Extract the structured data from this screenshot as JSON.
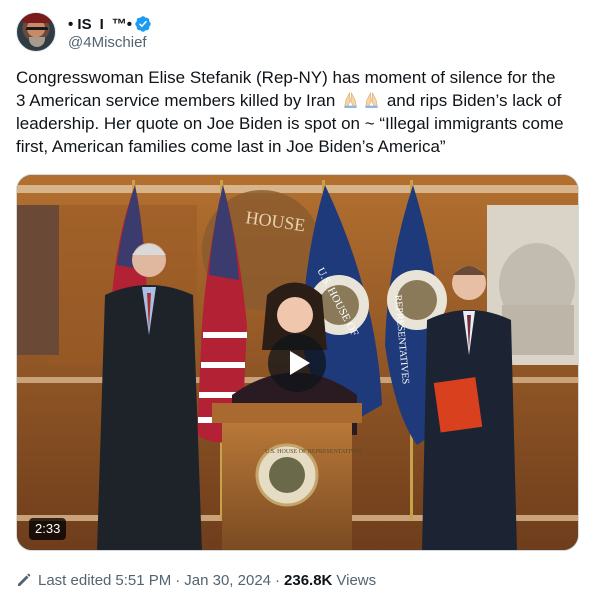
{
  "author": {
    "name_segments": [
      "• IS",
      "I",
      "™•"
    ],
    "handle": "@4Mischief",
    "avatar_icon": "avatar-photo",
    "verified_icon": "verified-badge-icon",
    "verified_color": "#1d9bf0"
  },
  "tweet": {
    "text_line1": "Congresswoman Elise Stefanik (Rep-NY) has moment of silence for the",
    "text_line2a": "3 American service members killed by Iran",
    "text_line2b": "and rips Biden’s lack of",
    "text_line3": "leadership. Her quote on Joe Biden is spot on ~ “Illegal immigrants come",
    "text_line4": "first, American families come last in Joe Biden’s America”",
    "emoji": [
      "folded-hands-icon",
      "folded-hands-icon"
    ]
  },
  "media": {
    "type": "video",
    "duration": "2:33",
    "seal_text_left": "HOUSE",
    "seal_text_flag1": "U.S. HOUSE OF",
    "seal_text_flag2": "REPRESENTATIVES",
    "podium_seal_text": "U.S. HOUSE OF REPRESENTATIVES"
  },
  "meta": {
    "edited_label": "Last edited",
    "time": "5:51 PM",
    "date": "Jan 30, 2024",
    "views_count": "236.8K",
    "views_label": "Views",
    "separator": "·"
  },
  "colors": {
    "text_primary": "#0f1419",
    "text_secondary": "#536471",
    "accent": "#1d9bf0"
  }
}
